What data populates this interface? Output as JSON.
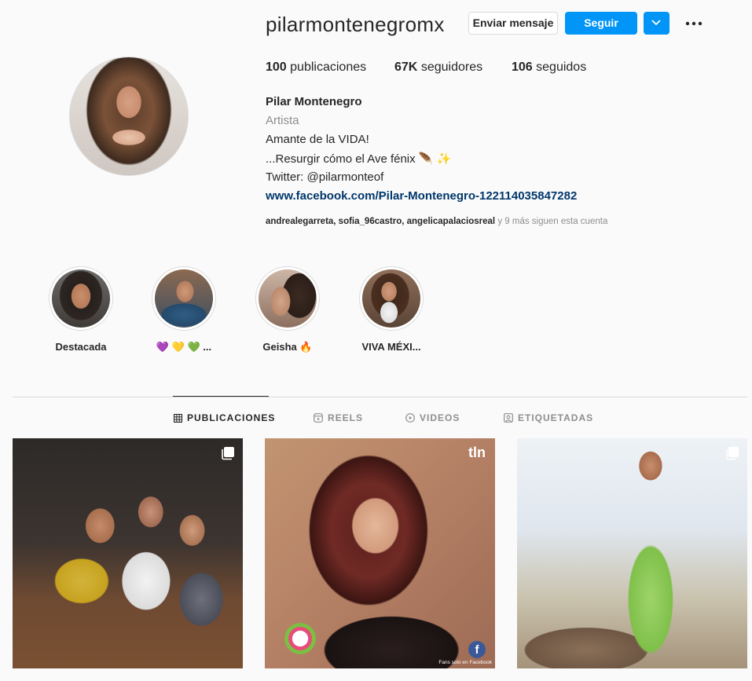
{
  "profile": {
    "username": "pilarmontenegromx",
    "buttons": {
      "message": "Enviar mensaje",
      "follow": "Seguir"
    },
    "stats": [
      {
        "value": "100",
        "label": "publicaciones"
      },
      {
        "value": "67K",
        "label": "seguidores"
      },
      {
        "value": "106",
        "label": "seguidos"
      }
    ],
    "full_name": "Pilar Montenegro",
    "category": "Artista",
    "bio": [
      "Amante de la VIDA!",
      "...Resurgir cómo el Ave fénix 🪶 ✨",
      "Twitter: @pilarmonteof"
    ],
    "link": "www.facebook.com/Pilar-Montenegro-122114035847282",
    "followed_by": {
      "users": "andrealegarreta, sofia_96castro, angelicapalaciosreal",
      "suffix": " y 9 más siguen esta cuenta"
    }
  },
  "highlights": [
    {
      "label": "Destacada"
    },
    {
      "label": "💜 💛 💚 ..."
    },
    {
      "label": "Geisha 🔥"
    },
    {
      "label": "VIVA MÉXI..."
    }
  ],
  "tabs": [
    {
      "label": "PUBLICACIONES",
      "icon": "grid-icon",
      "active": true
    },
    {
      "label": "REELS",
      "icon": "reels-icon",
      "active": false
    },
    {
      "label": "VIDEOS",
      "icon": "play-icon",
      "active": false
    },
    {
      "label": "ETIQUETADAS",
      "icon": "tag-icon",
      "active": false
    }
  ],
  "posts": [
    {
      "watermark": ""
    },
    {
      "watermark": "tln",
      "caption": "Fans solo en Facebook"
    },
    {
      "watermark": ""
    }
  ],
  "colors": {
    "accent": "#0095f6",
    "link": "#00376b",
    "muted": "#8e8e8e",
    "text": "#262626"
  }
}
